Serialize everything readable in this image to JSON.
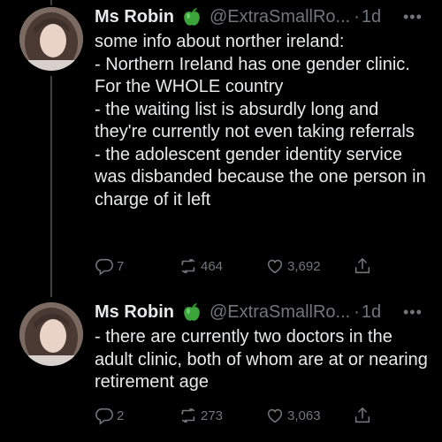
{
  "tweets": [
    {
      "name": "Ms Robin",
      "handle": "@ExtraSmallRo...",
      "dot": "·",
      "time": "1d",
      "more": "•••",
      "text": "some info about norther ireland:\n- Northern Ireland has one gender clinic. For the WHOLE country\n- the waiting list is absurdly long and they're currently not even taking referrals\n- the adolescent gender identity service was disbanded because the one person in charge of it left",
      "replies": "7",
      "retweets": "464",
      "likes": "3,692"
    },
    {
      "name": "Ms Robin",
      "handle": "@ExtraSmallRo...",
      "dot": "·",
      "time": "1d",
      "more": "•••",
      "text": "- there are currently two doctors in the adult clinic, both of whom are at or nearing retirement age",
      "replies": "2",
      "retweets": "273",
      "likes": "3,063"
    }
  ],
  "icons": {
    "name_badge": "green-apple-icon",
    "reply": "reply-icon",
    "retweet": "retweet-icon",
    "like": "like-icon",
    "share": "share-icon",
    "more": "more-icon"
  },
  "colors": {
    "background": "#000000",
    "text": "#e7e9ea",
    "secondary": "#71767b",
    "thread_line": "#3e4144",
    "apple": "#3ba53b"
  }
}
